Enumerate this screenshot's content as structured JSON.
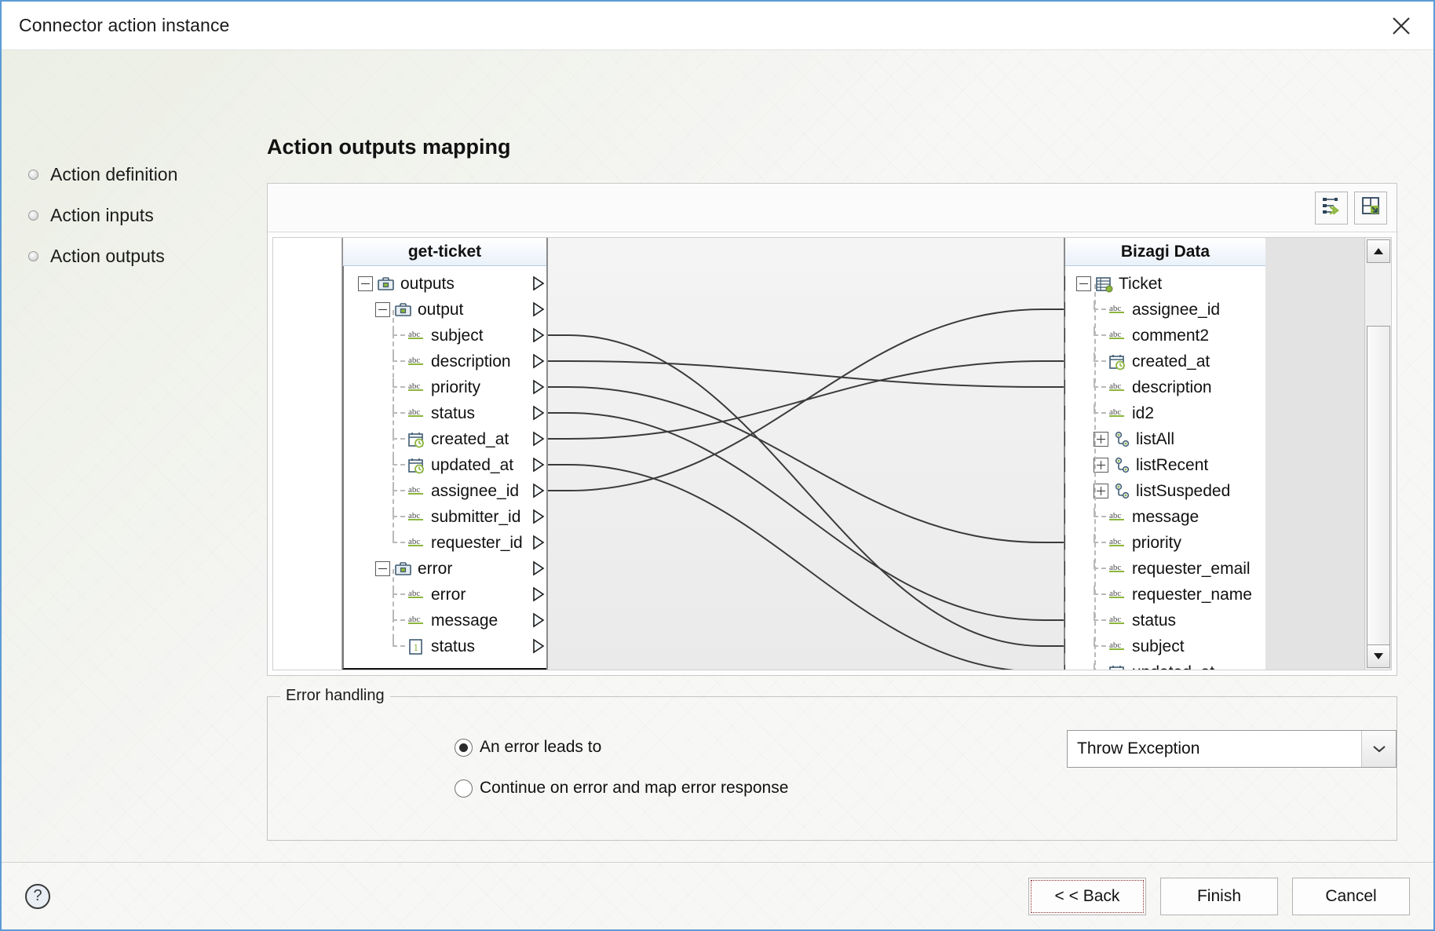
{
  "window": {
    "title": "Connector action instance",
    "close_icon": "close-icon"
  },
  "nav": {
    "items": [
      {
        "label": "Action definition"
      },
      {
        "label": "Action inputs"
      },
      {
        "label": "Action outputs"
      }
    ]
  },
  "page": {
    "title": "Action outputs mapping"
  },
  "toolbar": {
    "buttons": [
      {
        "name": "auto-map-button",
        "icon": "auto-map-icon"
      },
      {
        "name": "fit-layout-button",
        "icon": "expand-layout-icon"
      }
    ]
  },
  "mapper": {
    "left_panel": {
      "header": "get-ticket",
      "nodes": [
        {
          "label": "outputs",
          "icon": "briefcase-icon",
          "type": "object",
          "indent": 0,
          "expander": "minus"
        },
        {
          "label": "output",
          "icon": "briefcase-icon",
          "type": "object",
          "indent": 1,
          "expander": "minus"
        },
        {
          "label": "subject",
          "icon": "abc-icon",
          "type": "string",
          "indent": 2,
          "expander": "none"
        },
        {
          "label": "description",
          "icon": "abc-icon",
          "type": "string",
          "indent": 2,
          "expander": "none"
        },
        {
          "label": "priority",
          "icon": "abc-icon",
          "type": "string",
          "indent": 2,
          "expander": "none"
        },
        {
          "label": "status",
          "icon": "abc-icon",
          "type": "string",
          "indent": 2,
          "expander": "none"
        },
        {
          "label": "created_at",
          "icon": "datetime-icon",
          "type": "date",
          "indent": 2,
          "expander": "none"
        },
        {
          "label": "updated_at",
          "icon": "datetime-icon",
          "type": "date",
          "indent": 2,
          "expander": "none"
        },
        {
          "label": "assignee_id",
          "icon": "abc-icon",
          "type": "string",
          "indent": 2,
          "expander": "none"
        },
        {
          "label": "submitter_id",
          "icon": "abc-icon",
          "type": "string",
          "indent": 2,
          "expander": "none"
        },
        {
          "label": "requester_id",
          "icon": "abc-icon",
          "type": "string",
          "indent": 2,
          "expander": "none"
        },
        {
          "label": "error",
          "icon": "briefcase-icon",
          "type": "object",
          "indent": 1,
          "expander": "minus"
        },
        {
          "label": "error",
          "icon": "abc-icon",
          "type": "string",
          "indent": 2,
          "expander": "none"
        },
        {
          "label": "message",
          "icon": "abc-icon",
          "type": "string",
          "indent": 2,
          "expander": "none"
        },
        {
          "label": "status",
          "icon": "number-icon",
          "type": "number",
          "indent": 2,
          "expander": "none"
        }
      ]
    },
    "right_panel": {
      "header": "Bizagi Data",
      "nodes": [
        {
          "label": "Ticket",
          "icon": "entity-icon",
          "type": "entity",
          "indent": 0,
          "expander": "minus"
        },
        {
          "label": "assignee_id",
          "icon": "abc-icon",
          "type": "string",
          "indent": 1,
          "expander": "none"
        },
        {
          "label": "comment2",
          "icon": "abc-icon",
          "type": "string",
          "indent": 1,
          "expander": "none"
        },
        {
          "label": "created_at",
          "icon": "datetime-icon",
          "type": "date",
          "indent": 1,
          "expander": "none"
        },
        {
          "label": "description",
          "icon": "abc-icon",
          "type": "string",
          "indent": 1,
          "expander": "none"
        },
        {
          "label": "id2",
          "icon": "abc-icon",
          "type": "string",
          "indent": 1,
          "expander": "none"
        },
        {
          "label": "listAll",
          "icon": "collection-icon",
          "type": "collection",
          "indent": 1,
          "expander": "plus"
        },
        {
          "label": "listRecent",
          "icon": "collection-icon",
          "type": "collection",
          "indent": 1,
          "expander": "plus"
        },
        {
          "label": "listSuspeded",
          "icon": "collection-icon",
          "type": "collection",
          "indent": 1,
          "expander": "plus"
        },
        {
          "label": "message",
          "icon": "abc-icon",
          "type": "string",
          "indent": 1,
          "expander": "none"
        },
        {
          "label": "priority",
          "icon": "abc-icon",
          "type": "string",
          "indent": 1,
          "expander": "none"
        },
        {
          "label": "requester_email",
          "icon": "abc-icon",
          "type": "string",
          "indent": 1,
          "expander": "none"
        },
        {
          "label": "requester_name",
          "icon": "abc-icon",
          "type": "string",
          "indent": 1,
          "expander": "none"
        },
        {
          "label": "status",
          "icon": "abc-icon",
          "type": "string",
          "indent": 1,
          "expander": "none"
        },
        {
          "label": "subject",
          "icon": "abc-icon",
          "type": "string",
          "indent": 1,
          "expander": "none"
        },
        {
          "label": "updated_at",
          "icon": "datetime-icon",
          "type": "date",
          "indent": 1,
          "expander": "none"
        }
      ]
    },
    "links": [
      {
        "from": "subject",
        "to": "subject"
      },
      {
        "from": "description",
        "to": "description"
      },
      {
        "from": "priority",
        "to": "priority"
      },
      {
        "from": "status",
        "to": "status"
      },
      {
        "from": "created_at",
        "to": "created_at"
      },
      {
        "from": "updated_at",
        "to": "updated_at"
      },
      {
        "from": "assignee_id",
        "to": "assignee_id"
      }
    ],
    "scrollbar": {
      "up_icon": "scroll-up-icon",
      "down_icon": "scroll-down-icon"
    }
  },
  "error_handling": {
    "legend": "Error handling",
    "options": [
      {
        "label": "An error leads to",
        "selected": true
      },
      {
        "label": "Continue on error and map error response",
        "selected": false
      }
    ],
    "select": {
      "value": "Throw Exception",
      "arrow_icon": "chevron-down-icon"
    }
  },
  "footer": {
    "help_icon": "?",
    "buttons": [
      {
        "label": "< < Back",
        "name": "back-button"
      },
      {
        "label": "Finish",
        "name": "finish-button"
      },
      {
        "label": "Cancel",
        "name": "cancel-button"
      }
    ]
  },
  "colors": {
    "accent": "#5b9bd5",
    "header_gradient": "#eaf1fa",
    "icon_green": "#8cb63c",
    "icon_steel": "#3f5b72"
  }
}
